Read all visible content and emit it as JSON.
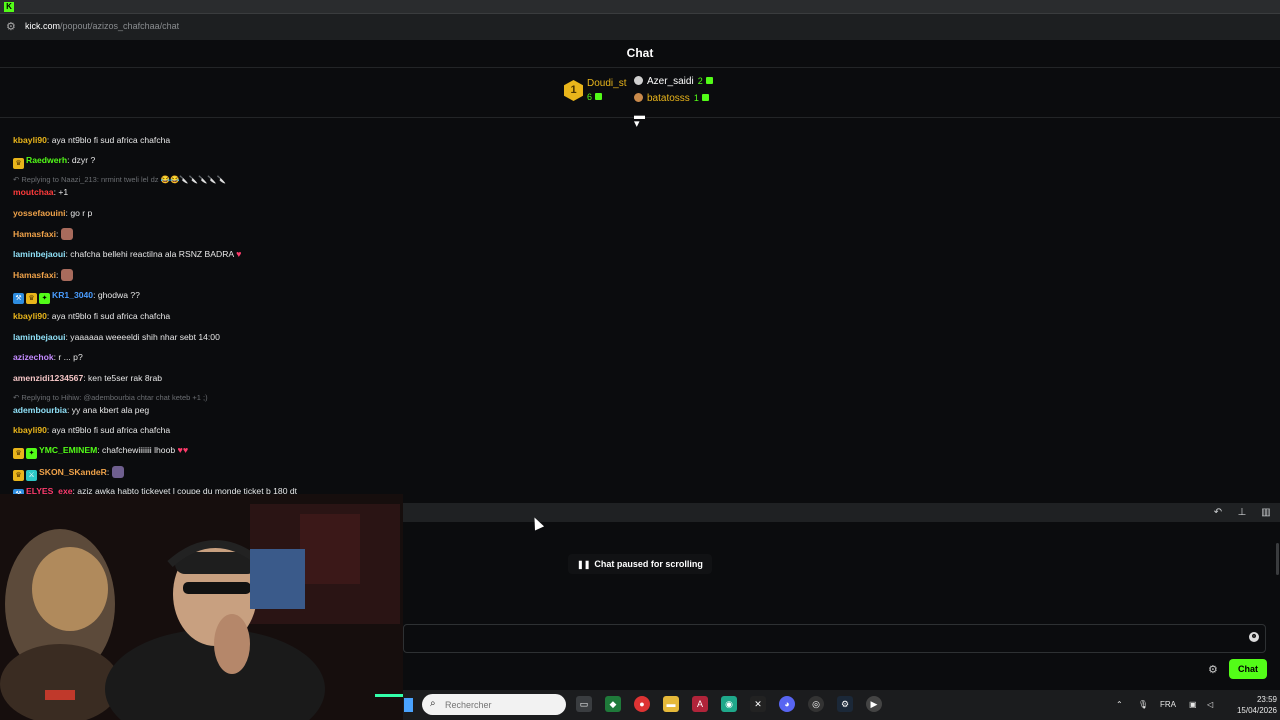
{
  "browser": {
    "url_host": "kick.com",
    "url_path": "/popout/azizos_chafchaa/chat"
  },
  "chat": {
    "title": "Chat",
    "leaderboard": [
      {
        "rank": "1",
        "name": "Doudi_st",
        "count": "6"
      },
      {
        "name": "Azer_saidi",
        "count": "2"
      },
      {
        "name": "batatosss",
        "count": "1"
      }
    ],
    "messages": [
      {
        "user": "kbayli90",
        "color": "#e9b51b",
        "text": ": aya nt9blo fi sud africa chafcha"
      },
      {
        "user": "Raedwerh",
        "color": "#53fc18",
        "text": ": dzyr ?"
      },
      {
        "reply": "Replying to Naazi_213: nrmint tweli lel dz 😂😂🔪🔪🔪🔪🔪"
      },
      {
        "user": "moutchaa",
        "color": "#ff3b3b",
        "text": ": +1"
      },
      {
        "user": "yossefaouini",
        "color": "#f0a34a",
        "text": ": go r p"
      },
      {
        "user": "Hamasfaxi",
        "color": "#f0a34a",
        "text": ":"
      },
      {
        "user": "laminbejaoui",
        "color": "#8fe0f7",
        "text": ": chafcha bellehi reactilna ala RSNZ BADRA"
      },
      {
        "user": "Hamasfaxi",
        "color": "#f0a34a",
        "text": ":"
      },
      {
        "user": "KR1_3040",
        "color": "#4a9dff",
        "text": ": ghodwa ??"
      },
      {
        "user": "kbayli90",
        "color": "#e9b51b",
        "text": ": aya nt9blo fi sud africa chafcha"
      },
      {
        "user": "laminbejaoui",
        "color": "#8fe0f7",
        "text": ": yaaaaaa weeeeldi shih nhar sebt 14:00"
      },
      {
        "user": "azizechok",
        "color": "#c48bff",
        "text": ": r ... p?"
      },
      {
        "user": "amenzidi1234567",
        "color": "#f5c6c6",
        "text": ": ken te5ser rak 8rab"
      },
      {
        "reply": "Replying to Hihiw: @adembourbia chtar chat keteb +1 ;)"
      },
      {
        "user": "adembourbia",
        "color": "#8fe0f7",
        "text": ": yy ana kbert ala peg"
      },
      {
        "user": "kbayli90",
        "color": "#e9b51b",
        "text": ": aya nt9blo fi sud africa chafcha"
      },
      {
        "user": "YMC_EMINEM",
        "color": "#53fc18",
        "text": ": chafchewiiiiiii lhoob"
      },
      {
        "user": "SKON_SKandeR",
        "color": "#f0a34a",
        "text": ":"
      },
      {
        "user": "ELYES_exe",
        "color": "#ff3b6b",
        "text": ": aziz awka habto tickevet l coupe du monde ticket b 180 dt"
      }
    ],
    "paused_label": "Chat paused for scrolling",
    "input_placeholder": "",
    "send_label": "Chat"
  },
  "taskbar": {
    "search_placeholder": "Rechercher",
    "lang": "FRA",
    "time": "23:59",
    "date": "15/04/2026"
  },
  "colors": {
    "accent": "#53fc18",
    "gold": "#e9b51b",
    "background": "#0b0c0e"
  }
}
